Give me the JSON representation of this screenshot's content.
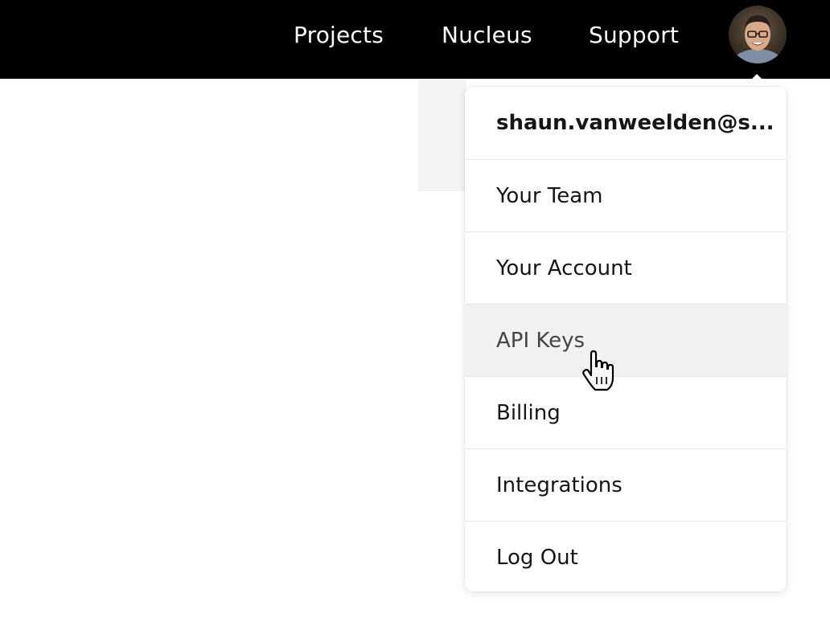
{
  "nav": {
    "links": [
      {
        "label": "Projects"
      },
      {
        "label": "Nucleus"
      },
      {
        "label": "Support"
      }
    ],
    "avatar_icon": "user-avatar"
  },
  "menu": {
    "email": "shaun.vanweelden@s...",
    "items": [
      {
        "label": "Your Team"
      },
      {
        "label": "Your Account"
      },
      {
        "label": "API Keys",
        "hovered": true
      },
      {
        "label": "Billing"
      },
      {
        "label": "Integrations"
      },
      {
        "label": "Log Out"
      }
    ]
  },
  "colors": {
    "topbar": "#000000",
    "hover_bg": "#f1f1f1",
    "text": "#161616"
  }
}
